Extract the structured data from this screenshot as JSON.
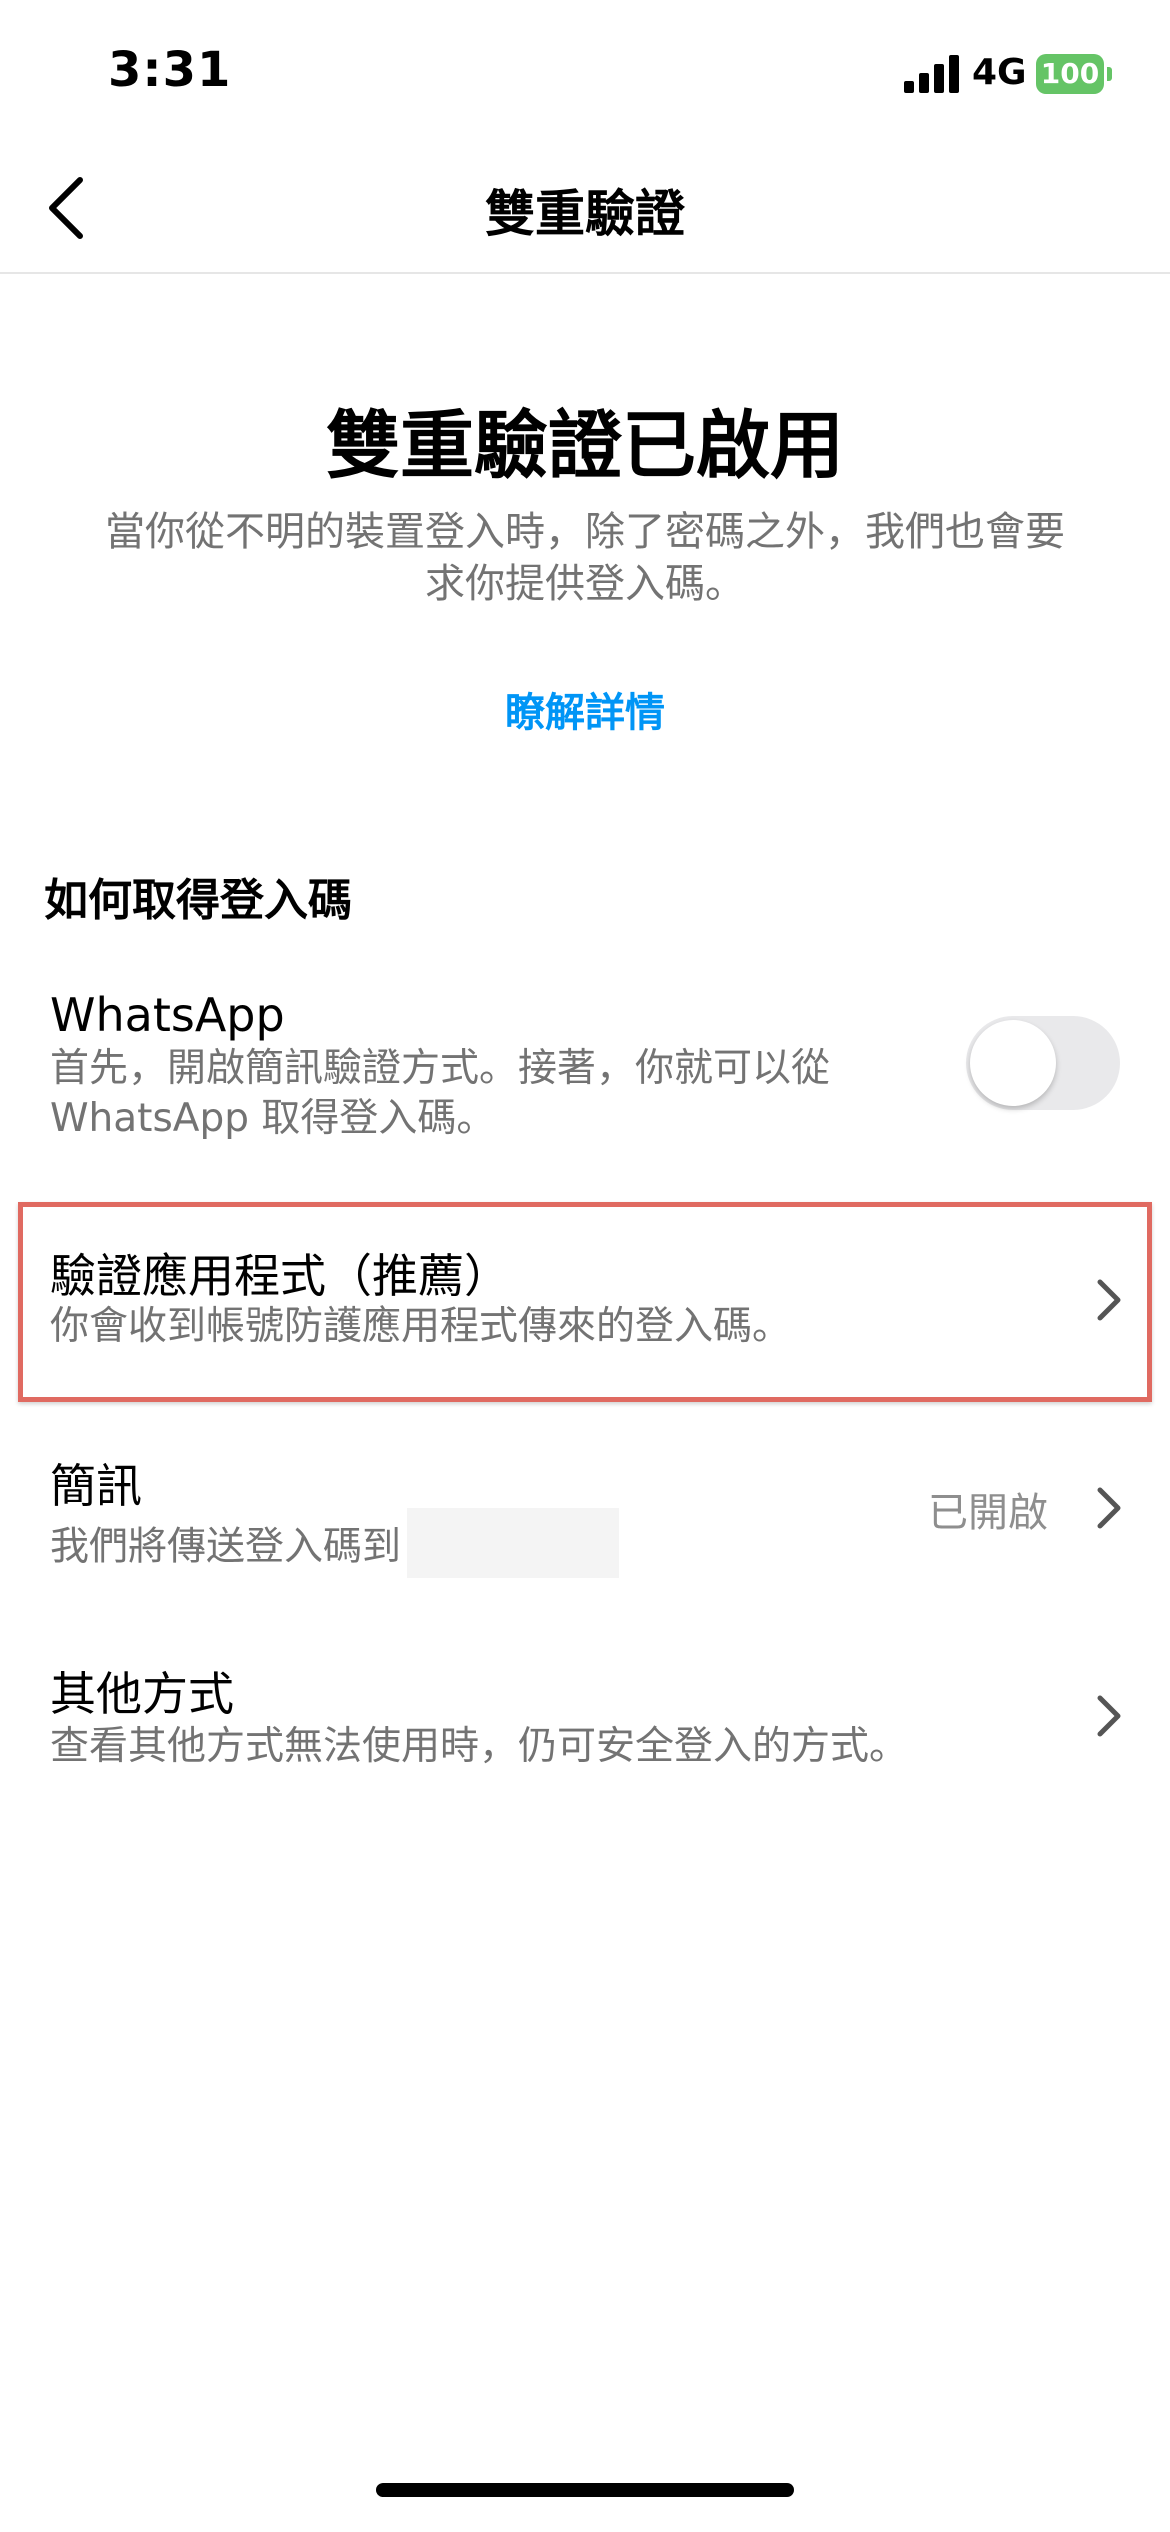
{
  "status_bar": {
    "time": "3:31",
    "network": "4G",
    "battery": "100"
  },
  "header": {
    "title": "雙重驗證"
  },
  "hero": {
    "title": "雙重驗證已啟用",
    "description": "當你從不明的裝置登入時，除了密碼之外，我們也會要求你提供登入碼。",
    "learn_more": "瞭解詳情"
  },
  "section": {
    "title": "如何取得登入碼"
  },
  "options": {
    "whatsapp": {
      "title": "WhatsApp",
      "description": "首先，開啟簡訊驗證方式。接著，你就可以從WhatsApp 取得登入碼。",
      "enabled": false
    },
    "auth_app": {
      "title": "驗證應用程式（推薦）",
      "description": "你會收到帳號防護應用程式傳來的登入碼。"
    },
    "sms": {
      "title": "簡訊",
      "description": "我們將傳送登入碼到",
      "status": "已開啟"
    },
    "other": {
      "title": "其他方式",
      "description": "查看其他方式無法使用時，仍可安全登入的方式。"
    }
  },
  "colors": {
    "link": "#0095f6",
    "battery": "#65c466",
    "highlight": "#e06a61"
  }
}
